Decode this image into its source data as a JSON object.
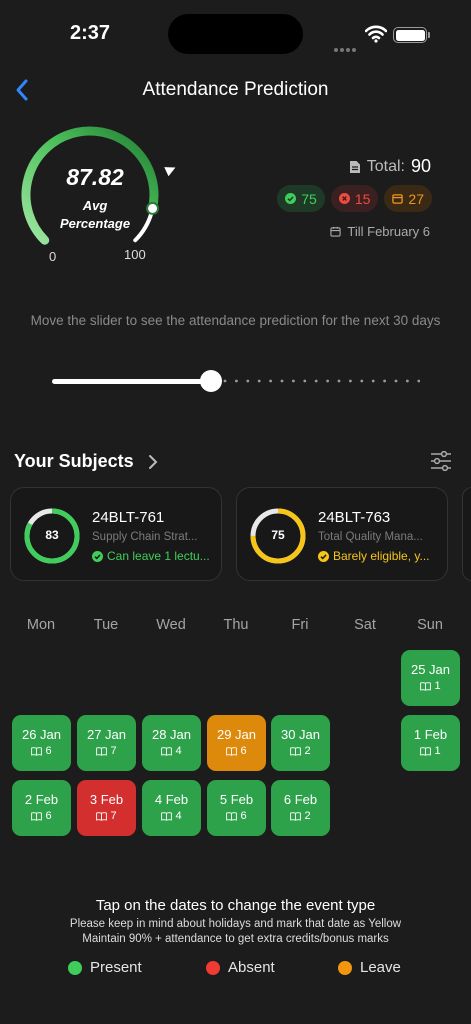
{
  "status_bar": {
    "time": "2:37"
  },
  "header": {
    "title": "Attendance Prediction"
  },
  "gauge": {
    "value": "87.82",
    "label_line1": "Avg",
    "label_line2": "Percentage",
    "min_label": "0",
    "max_label": "100",
    "fraction": 0.8782
  },
  "stats": {
    "total_label": "Total:",
    "total_value": "90",
    "present": "75",
    "absent": "15",
    "leave": "27",
    "till": "Till February 6"
  },
  "slider": {
    "hint": "Move the slider to see the attendance prediction for the next 30 days",
    "position_fraction": 0.43
  },
  "subjects": {
    "title": "Your Subjects",
    "cards": [
      {
        "percent": "83",
        "code": "24BLT-761",
        "name": "Supply Chain Strat...",
        "note": "Can leave 1 lectu...",
        "color": "#3fce5b"
      },
      {
        "percent": "75",
        "code": "24BLT-763",
        "name": "Total Quality Mana...",
        "note": "Barely eligible, y...",
        "color": "#f5c518"
      }
    ]
  },
  "calendar": {
    "weekdays": [
      "Mon",
      "Tue",
      "Wed",
      "Thu",
      "Fri",
      "Sat",
      "Sun"
    ],
    "days": [
      {
        "date": "25 Jan",
        "count": "1",
        "status": "present"
      },
      {
        "date": "26 Jan",
        "count": "6",
        "status": "present"
      },
      {
        "date": "27 Jan",
        "count": "7",
        "status": "present"
      },
      {
        "date": "28 Jan",
        "count": "4",
        "status": "present"
      },
      {
        "date": "29 Jan",
        "count": "6",
        "status": "leave"
      },
      {
        "date": "30 Jan",
        "count": "2",
        "status": "present"
      },
      {
        "date": "1 Feb",
        "count": "1",
        "status": "present"
      },
      {
        "date": "2 Feb",
        "count": "6",
        "status": "present"
      },
      {
        "date": "3 Feb",
        "count": "7",
        "status": "absent"
      },
      {
        "date": "4 Feb",
        "count": "4",
        "status": "present"
      },
      {
        "date": "5 Feb",
        "count": "6",
        "status": "present"
      },
      {
        "date": "6 Feb",
        "count": "2",
        "status": "present"
      }
    ]
  },
  "footer": {
    "tap": "Tap on the dates to change the event type",
    "note1": "Please keep in mind about holidays and mark that date as Yellow",
    "note2": "Maintain 90% + attendance to get extra credits/bonus marks",
    "legend": [
      {
        "label": "Present",
        "color": "#3fce5b"
      },
      {
        "label": "Absent",
        "color": "#ef3b33"
      },
      {
        "label": "Leave",
        "color": "#f2960f"
      }
    ]
  }
}
